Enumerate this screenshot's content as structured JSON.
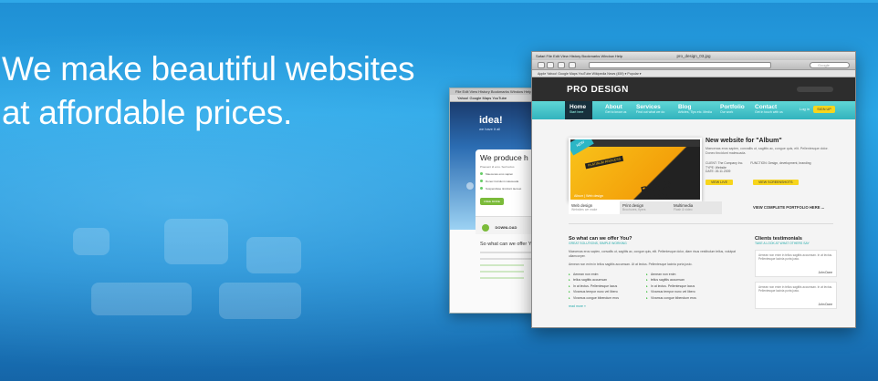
{
  "banner": {
    "headline_line1": "We make beautiful websites",
    "headline_line2": "at affordable prices."
  },
  "back_window": {
    "logo": "idea!",
    "logo_sub": "we have it all",
    "heading": "We produce h",
    "list": [
      "Maecenas eros sapien",
      "Donec tincidunt malesuada",
      "Suspendisse tincidunt laoreet"
    ],
    "button": "FREE MODE",
    "download": "DOWNLOAD",
    "section_title": "So what can we offer Y"
  },
  "front_window": {
    "window_title": "pro_design_03.jpg",
    "menu": "Safari  File  Edit  View  History  Bookmarks  Window  Help",
    "bookmarks": "Apple  Yahoo!  Google Maps  YouTube  Wikipedia  News (459) ▾  Popular ▾",
    "search_placeholder": "Google",
    "logo": "PRO DESIGN",
    "nav": [
      {
        "label": "Home",
        "sub": "Start here"
      },
      {
        "label": "About",
        "sub": "Get to know us"
      },
      {
        "label": "Services",
        "sub": "Find out what we do"
      },
      {
        "label": "Blog",
        "sub": "Articles, Tips etc. Media"
      },
      {
        "label": "Portfolio",
        "sub": "Our work"
      },
      {
        "label": "Contact",
        "sub": "Get in touch with us"
      }
    ],
    "login": "Log in",
    "signup": "SIGN UP",
    "feature": {
      "badge": "NEW",
      "platinum": "PLATINUM PROCESS",
      "big_text": "BUILD STAR",
      "caption": "Album | Web design",
      "news_title": "New website for \"Album\"",
      "news_text": "Maecenas eros sapien, convallis ut, sagittis ac, congue quis, elit. Pellentesque dolor. Donec tincidunt malesuada.",
      "client_label": "CLIENT: The Company Inc.",
      "type_label": "TYPE: Website",
      "date_label": "DATE: 26.11.2009",
      "function_label": "FUNCTION: Design, development, branding",
      "view_live": "VIEW LIVE",
      "view_screenshots": "VIEW SCREENSHOTS"
    },
    "tabs": [
      {
        "label": "Web design",
        "sub": "Websites we make"
      },
      {
        "label": "Print design",
        "sub": "Brochures, flyers"
      },
      {
        "label": "Multimedia",
        "sub": "Flash & video"
      }
    ],
    "view_all": "VIEW COMPLETE PORTFOLIO HERE ...",
    "offer": {
      "title": "So what can we offer You?",
      "subtitle": "GREAT SOLUTIONS, SIMPLE WORKING",
      "para1": "Maecenas eros sapien, convallis ut, sagittis ac, congue quis, elit. Pellentesque dolor, diam risus vestibulum tellus, volutpat ullamcorper.",
      "para2": "Aenean non enim in tellus sagittis accumsan. Ut at lectus. Pellentesque lacinia porta justo.",
      "list_left": [
        "Aenean non enim",
        "tellus sagittis accumsan",
        "In at lectus. Pellentesque lacus",
        "Vivamus tempor nunc vel libero",
        "Vivamus congue bibendum eros"
      ],
      "list_right": [
        "Aenean non enim",
        "tellus sagittis accumsan",
        "In at lectus. Pellentesque lacus",
        "Vivamus tempor nunc vel libero",
        "Vivamus congue bibendum eros"
      ],
      "more": "read more »"
    },
    "testimonials": {
      "title": "Clients testimonials",
      "subtitle": "TAKE A LOOK AT WHAT OTHERS SAY",
      "items": [
        {
          "text": "Aenean non enim in tellus sagittis accumsan. In at lectus. Pellentesque lacinia porta justo.",
          "author": "John Done"
        },
        {
          "text": "Aenean non enim in tellus sagittis accumsan. In at lectus. Pellentesque lacinia porta justo.",
          "author": "John Done"
        }
      ]
    }
  }
}
